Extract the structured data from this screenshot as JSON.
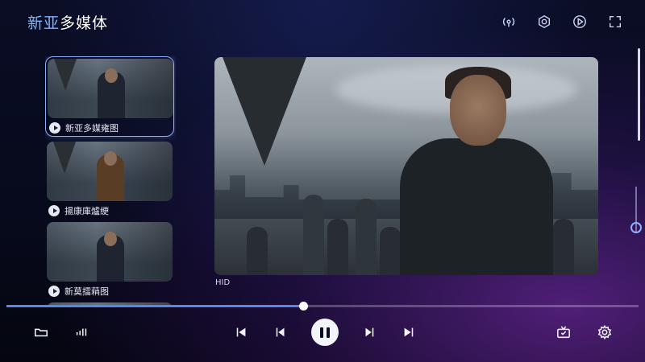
{
  "app": {
    "title_accent": "新亚",
    "title_rest": "多媒体"
  },
  "top_icons": [
    "cast-icon",
    "hexagon-settings-icon",
    "play-circle-icon",
    "fullscreen-icon"
  ],
  "playlist": [
    {
      "label": "新亚多媒雍图",
      "selected": true
    },
    {
      "label": "揚康庫爐绠",
      "selected": false
    },
    {
      "label": "新莫擂蕱图",
      "selected": false
    },
    {
      "label": "",
      "selected": false
    }
  ],
  "player": {
    "caption": "HID",
    "progress": 0.47
  },
  "controls": {
    "left": [
      "folder-icon",
      "equalizer-icon"
    ],
    "center": [
      "skip-start-icon",
      "skip-back-icon",
      "pause-icon",
      "skip-forward-icon",
      "skip-end-icon"
    ],
    "right": [
      "tv-icon",
      "settings-gear-icon"
    ]
  },
  "colors": {
    "accent": "#7fb4ff",
    "progress": "#5a86e8",
    "background": "#070a1c"
  }
}
